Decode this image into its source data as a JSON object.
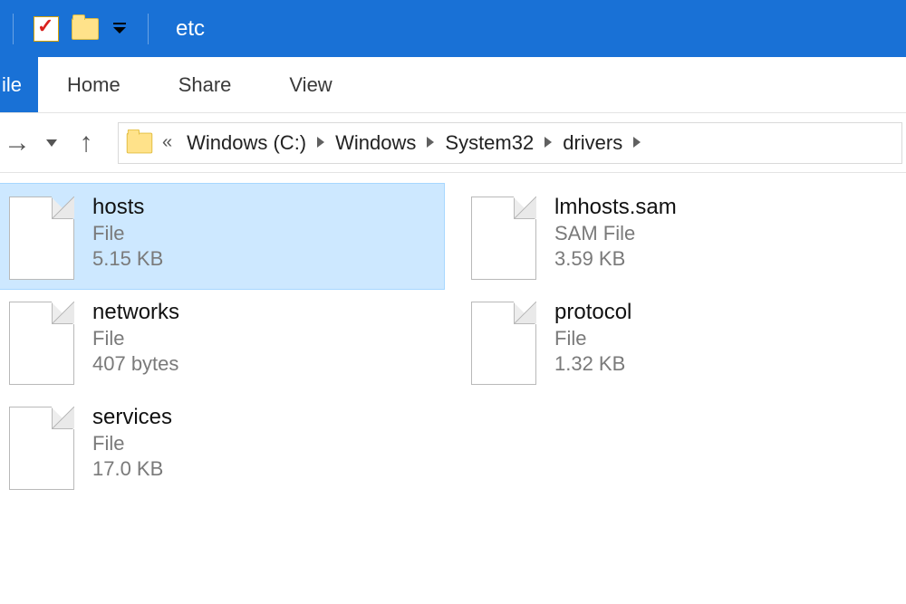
{
  "window": {
    "title": "etc"
  },
  "ribbon": {
    "file_label": "ile",
    "tabs": [
      "Home",
      "Share",
      "View"
    ]
  },
  "breadcrumb": {
    "prefix": "«",
    "segments": [
      "Windows (C:)",
      "Windows",
      "System32",
      "drivers"
    ]
  },
  "files": [
    {
      "name": "hosts",
      "type": "File",
      "size": "5.15 KB",
      "selected": true
    },
    {
      "name": "lmhosts.sam",
      "type": "SAM File",
      "size": "3.59 KB",
      "selected": false
    },
    {
      "name": "networks",
      "type": "File",
      "size": "407 bytes",
      "selected": false
    },
    {
      "name": "protocol",
      "type": "File",
      "size": "1.32 KB",
      "selected": false
    },
    {
      "name": "services",
      "type": "File",
      "size": "17.0 KB",
      "selected": false
    }
  ]
}
